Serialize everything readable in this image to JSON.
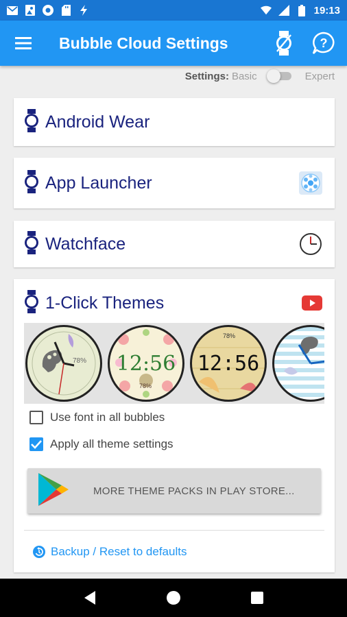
{
  "status": {
    "time": "19:13",
    "left_icons": [
      "mail-icon",
      "photo-icon",
      "sync-icon",
      "sd-card-icon",
      "flash-icon"
    ],
    "right_icons": [
      "wifi-icon",
      "signal-icon",
      "battery-icon"
    ]
  },
  "app_bar": {
    "title": "Bubble Cloud Settings",
    "menu_icon": "hamburger-menu-icon",
    "actions": [
      "watch-toggle-icon",
      "help-icon"
    ]
  },
  "mode": {
    "label": "Settings:",
    "basic": "Basic",
    "expert": "Expert",
    "expert_enabled": false
  },
  "sections": {
    "android_wear": {
      "title": "Android Wear"
    },
    "app_launcher": {
      "title": "App Launcher",
      "icon": "launcher-bubbles-icon"
    },
    "watchface": {
      "title": "Watchface",
      "icon": "clock-icon"
    },
    "themes": {
      "title": "1-Click Themes",
      "icon": "youtube-icon",
      "thumbnails": [
        {
          "name": "theme-palette",
          "kind": "analog",
          "label": "78%"
        },
        {
          "name": "theme-floral",
          "kind": "digital",
          "time": "12:56",
          "label": "78%"
        },
        {
          "name": "theme-handwritten",
          "kind": "digital",
          "time": "12:56",
          "label": "78%"
        },
        {
          "name": "theme-stripes",
          "kind": "analog",
          "label": ""
        }
      ],
      "options": [
        {
          "label": "Use font in all bubbles",
          "checked": false
        },
        {
          "label": "Apply all theme settings",
          "checked": true
        }
      ],
      "store_button": "MORE THEME PACKS IN PLAY STORE...",
      "backup_link": "Backup / Reset to defaults"
    }
  },
  "nav": [
    "back-icon",
    "home-icon",
    "recents-icon"
  ],
  "colors": {
    "status_bar": "#1976d2",
    "app_bar": "#2196f3",
    "title_text": "#1a237e",
    "accent": "#2196f3"
  }
}
